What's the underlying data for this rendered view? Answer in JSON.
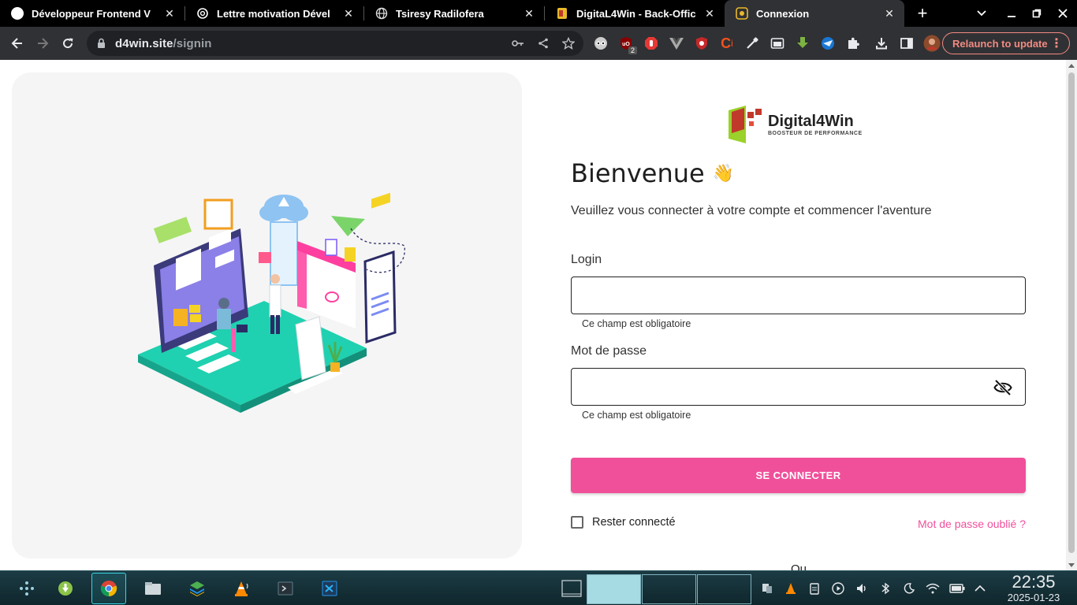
{
  "browser": {
    "tabs": [
      {
        "title": "Développeur Frontend V",
        "icon": "globe-icon"
      },
      {
        "title": "Lettre motivation Dével",
        "icon": "chatgpt-icon"
      },
      {
        "title": "Tsiresy Radilofera",
        "icon": "globe-icon"
      },
      {
        "title": "DigitaL4Win - Back-Offic",
        "icon": "d4w-favicon-icon"
      },
      {
        "title": "Connexion",
        "icon": "d4w-favicon-icon"
      }
    ],
    "url_host": "d4win.site",
    "url_path": "/signin",
    "relaunch_label": "Relaunch to update",
    "ext_badge": "2"
  },
  "page": {
    "logo_brand": "Digital4Win",
    "logo_tagline": "BOOSTEUR DE PERFORMANCE",
    "title": "Bienvenue",
    "title_emoji": "👋",
    "subtitle": "Veuillez vous connecter à votre compte et commencer l'aventure",
    "login_label": "Login",
    "login_value": "",
    "login_helper": "Ce champ est obligatoire",
    "password_label": "Mot de passe",
    "password_value": "",
    "password_helper": "Ce champ est obligatoire",
    "submit_label": "SE CONNECTER",
    "remember_label": "Rester connecté",
    "remember_checked": false,
    "forgot_label": "Mot de passe oublié ?",
    "or_label": "Ou"
  },
  "colors": {
    "accent": "#f0509a",
    "browser_dark": "#303134",
    "panel_bg": "#f5f5f5"
  },
  "taskbar": {
    "time": "22:35",
    "date": "2025-01-23"
  }
}
